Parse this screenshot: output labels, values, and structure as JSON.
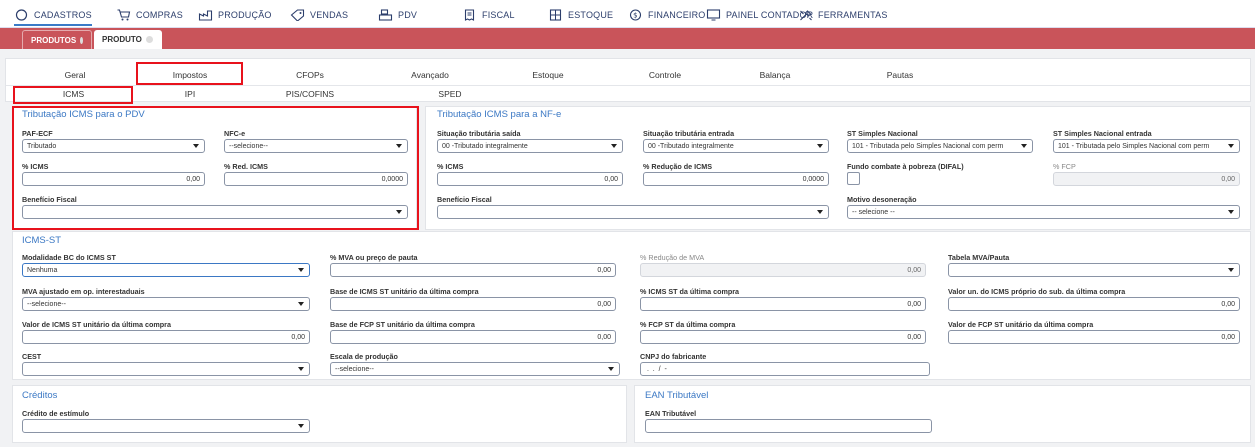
{
  "nav": [
    {
      "label": "CADASTROS",
      "icon": "circle-icon"
    },
    {
      "label": "COMPRAS",
      "icon": "cart-icon"
    },
    {
      "label": "PRODUÇÃO",
      "icon": "factory-icon"
    },
    {
      "label": "VENDAS",
      "icon": "tag-icon"
    },
    {
      "label": "PDV",
      "icon": "register-icon"
    },
    {
      "label": "FISCAL",
      "icon": "receipt-icon"
    },
    {
      "label": "ESTOQUE",
      "icon": "warehouse-icon"
    },
    {
      "label": "FINANCEIRO",
      "icon": "dollar-icon"
    },
    {
      "label": "PAINEL CONTADOR",
      "icon": "monitor-icon"
    },
    {
      "label": "FERRAMENTAS",
      "icon": "tools-icon"
    }
  ],
  "page_tabs": [
    "PRODUTOS",
    "PRODUTO"
  ],
  "tabs": [
    "Geral",
    "Impostos",
    "CFOPs",
    "Avançado",
    "Estoque",
    "Controle",
    "Balança",
    "Pautas"
  ],
  "subtabs": [
    "ICMS",
    "IPI",
    "PIS/COFINS",
    "SPED"
  ],
  "pdv": {
    "title": "Tributação ICMS para o PDV",
    "paf_label": "PAF-ECF",
    "paf_value": "Tributado",
    "nfce_label": "NFC-e",
    "nfce_value": "--selecione--",
    "icms_label": "% ICMS",
    "icms_value": "0,00",
    "red_label": "% Red. ICMS",
    "red_value": "0,0000",
    "benef_label": "Benefício Fiscal",
    "benef_value": ""
  },
  "nfe": {
    "title": "Tributação ICMS para a NF-e",
    "saida_label": "Situação tributária saída",
    "saida_value": "00 -Tributado integralmente",
    "entrada_label": "Situação tributária entrada",
    "entrada_value": "00 -Tributado integralmente",
    "stsn_label": "ST Simples Nacional",
    "stsn_value": "101 - Tributada pelo Simples Nacional com perm",
    "stsne_label": "ST Simples Nacional entrada",
    "stsne_value": "101 - Tributada pelo Simples Nacional com perm",
    "icms_label": "% ICMS",
    "icms_value": "0,00",
    "red_label": "% Redução de ICMS",
    "red_value": "0,0000",
    "fundo_label": "Fundo combate à pobreza (DIFAL)",
    "fcp_label": "% FCP",
    "fcp_value": "0,00",
    "benef_label": "Benefício Fiscal",
    "benef_value": "",
    "motivo_label": "Motivo desoneração",
    "motivo_value": "-- selecione --"
  },
  "icmsst": {
    "title": "ICMS-ST",
    "mod_label": "Modalidade BC do ICMS ST",
    "mod_value": "Nenhuma",
    "mva_label": "% MVA ou preço de pauta",
    "mva_value": "0,00",
    "redmva_label": "% Redução de MVA",
    "redmva_value": "0,00",
    "tab_label": "Tabela MVA/Pauta",
    "tab_value": "",
    "mvaaj_label": "MVA ajustado em op. interestaduais",
    "mvaaj_value": "--selecione--",
    "base_label": "Base de ICMS ST unitário da última compra",
    "base_value": "0,00",
    "pst_label": "% ICMS ST da última compra",
    "pst_value": "0,00",
    "valun_label": "Valor un. do ICMS próprio do sub. da última compra",
    "valun_value": "0,00",
    "vst_label": "Valor de ICMS ST unitário da última compra",
    "vst_value": "0,00",
    "bfcp_label": "Base de FCP ST unitário da última compra",
    "bfcp_value": "0,00",
    "pfcp_label": "% FCP ST da última compra",
    "pfcp_value": "0,00",
    "vfcp_label": "Valor de FCP ST unitário da última compra",
    "vfcp_value": "0,00",
    "cest_label": "CEST",
    "cest_value": "",
    "escala_label": "Escala de produção",
    "escala_value": "--selecione--",
    "cnpj_label": "CNPJ do fabricante",
    "cnpj_value": " .  .  /  -"
  },
  "creditos": {
    "title": "Créditos",
    "label": "Crédito de estímulo",
    "value": ""
  },
  "ean": {
    "title": "EAN Tributável",
    "label": "EAN Tributável",
    "value": ""
  },
  "colors": {
    "accent": "#3b78c4",
    "redbar": "#c9545a",
    "highlight": "#e8121c"
  }
}
